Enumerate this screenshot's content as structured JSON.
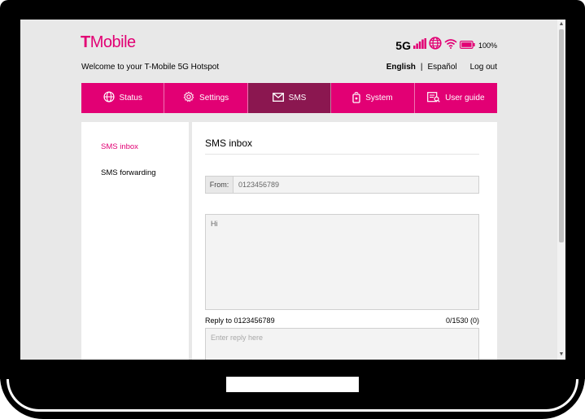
{
  "brand": {
    "logo_t": "T",
    "logo_text": "Mobile",
    "accent": "#e20074",
    "active_tab_color": "#8b1750"
  },
  "status": {
    "network": "5G",
    "battery": "100%",
    "icons": [
      "signal-bars-icon",
      "globe-icon",
      "wifi-icon",
      "battery-icon"
    ]
  },
  "header": {
    "welcome": "Welcome to your T-Mobile 5G Hotspot",
    "lang_english": "English",
    "lang_separator": "|",
    "lang_spanish": "Español",
    "logout": "Log out"
  },
  "nav": {
    "tabs": [
      {
        "label": "Status",
        "icon": "globe-icon"
      },
      {
        "label": "Settings",
        "icon": "gear-icon"
      },
      {
        "label": "SMS",
        "icon": "envelope-icon"
      },
      {
        "label": "System",
        "icon": "device-icon"
      },
      {
        "label": "User guide",
        "icon": "book-icon"
      }
    ]
  },
  "sidebar": {
    "items": [
      {
        "label": "SMS inbox"
      },
      {
        "label": "SMS forwarding"
      }
    ]
  },
  "main": {
    "title": "SMS inbox",
    "from_label": "From:",
    "from_value": "0123456789",
    "message": "Hi",
    "reply_label": "Reply to 0123456789",
    "reply_count": "0/1530 (0)",
    "reply_placeholder": "Enter reply here"
  }
}
